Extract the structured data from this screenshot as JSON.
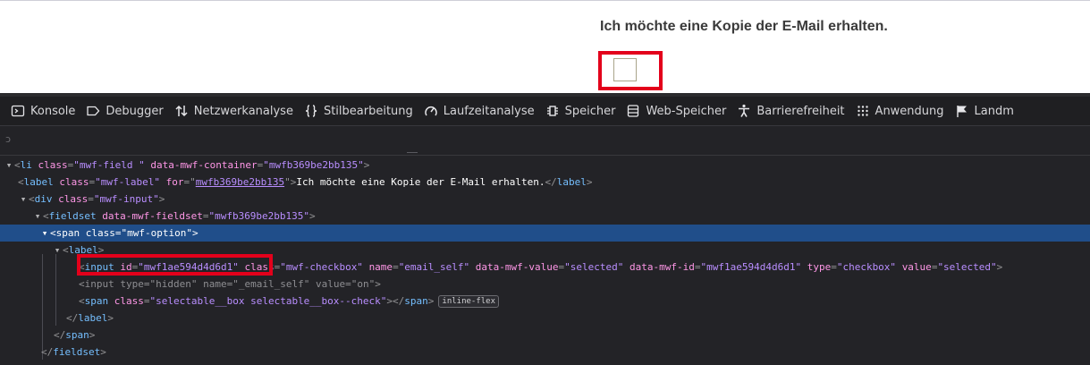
{
  "page": {
    "label_text": "Ich möchte eine Kopie der E-Mail erhalten."
  },
  "devtools": {
    "tabs": [
      {
        "label": "Konsole",
        "icon": "console-icon"
      },
      {
        "label": "Debugger",
        "icon": "debugger-icon"
      },
      {
        "label": "Netzwerkanalyse",
        "icon": "network-icon"
      },
      {
        "label": "Stilbearbeitung",
        "icon": "style-editor-icon"
      },
      {
        "label": "Laufzeitanalyse",
        "icon": "performance-icon"
      },
      {
        "label": "Speicher",
        "icon": "memory-icon"
      },
      {
        "label": "Web-Speicher",
        "icon": "storage-icon"
      },
      {
        "label": "Barrierefreiheit",
        "icon": "accessibility-icon"
      },
      {
        "label": "Anwendung",
        "icon": "application-icon"
      },
      {
        "label": "Landm",
        "icon": "flag-icon"
      }
    ],
    "search_mark": "ↄ",
    "markup": {
      "li_tag": "li",
      "li_class_attr": "class",
      "li_class_val": "\"mwf-field \"",
      "li_container_attr": "data-mwf-container",
      "li_container_val": "\"mwfb369be2bb135\"",
      "label_tag": "label",
      "label_class_attr": "class",
      "label_class_val": "\"mwf-label\"",
      "label_for_attr": "for",
      "label_for_val": "mwfb369be2bb135",
      "label_text": "Ich möchte eine Kopie der E-Mail erhalten.",
      "div_tag": "div",
      "div_class_attr": "class",
      "div_class_val": "\"mwf-input\"",
      "fieldset_tag": "fieldset",
      "fieldset_attr": "data-mwf-fieldset",
      "fieldset_val": "\"mwfb369be2bb135\"",
      "span_tag": "span",
      "span_class_attr": "class",
      "span_class_val": "\"mwf-option\"",
      "label2_tag": "label",
      "input_tag": "input",
      "input_id_attr": "id",
      "input_id_val": "\"mwf1ae594d4d6d1\"",
      "input_class_attr": "class",
      "input_class_val": "\"mwf-checkbox\"",
      "input_name_attr": "name",
      "input_name_val": "\"email_self\"",
      "input_dvalue_attr": "data-mwf-value",
      "input_dvalue_val": "\"selected\"",
      "input_did_attr": "data-mwf-id",
      "input_did_val": "\"mwf1ae594d4d6d1\"",
      "input_type_attr": "type",
      "input_type_val": "\"checkbox\"",
      "input_value_attr": "value",
      "input_value_val": "\"selected\"",
      "hidden_tag": "input",
      "hidden_type_attr": "type",
      "hidden_type_val": "\"hidden\"",
      "hidden_name_attr": "name",
      "hidden_name_val": "\"_email_self\"",
      "hidden_value_attr": "value",
      "hidden_value_val": "\"on\"",
      "span2_tag": "span",
      "span2_class_attr": "class",
      "span2_class_val": "\"selectable__box selectable__box--check\"",
      "span2_badge": "inline-flex",
      "close_label": "label",
      "close_span": "span",
      "close_fieldset": "fieldset"
    }
  },
  "colors": {
    "highlight": "#e3001b",
    "selected_row": "#204e8a",
    "devtools_bg": "#232327"
  }
}
